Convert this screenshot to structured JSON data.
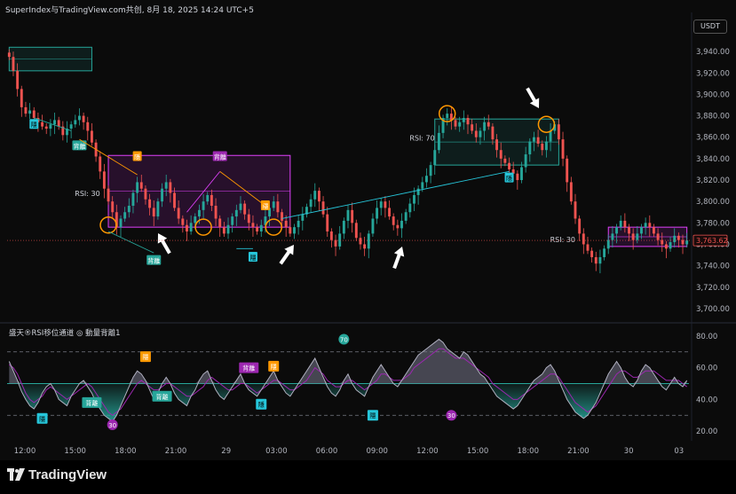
{
  "header": {
    "title": "SuperIndex与TradingView.com共创, 8月 18, 2025 14:24 UTC+5",
    "currency": "USDT",
    "brand": "TradingView"
  },
  "indicator": {
    "legend": "盛天®RSI移位通道 ◎ 動量背離1"
  },
  "colors": {
    "up": "#26a69a",
    "down": "#ef5350",
    "rsi_hi": "#e040fb",
    "rsi_lo": "#26c6da",
    "orange": "#ff9800",
    "background": "#0b0b0b"
  },
  "chart_data": [
    {
      "type": "candlestick",
      "title": "",
      "x_ticks": [
        "12:00",
        "15:00",
        "18:00",
        "21:00",
        "29",
        "03:00",
        "06:00",
        "09:00",
        "12:00",
        "15:00",
        "18:00",
        "21:00",
        "30",
        "03"
      ],
      "y_ticks": [
        3940,
        3920,
        3900,
        3880,
        3860,
        3840,
        3820,
        3800,
        3780,
        3760,
        3740,
        3720,
        3700
      ],
      "ylim": [
        3690,
        3955
      ],
      "last_price": "3,763.62",
      "close": [
        3935,
        3922,
        3905,
        3888,
        3882,
        3885,
        3878,
        3874,
        3870,
        3868,
        3872,
        3876,
        3870,
        3862,
        3868,
        3872,
        3876,
        3880,
        3874,
        3866,
        3855,
        3842,
        3828,
        3812,
        3800,
        3790,
        3776,
        3784,
        3790,
        3796,
        3808,
        3818,
        3812,
        3802,
        3794,
        3786,
        3800,
        3812,
        3818,
        3808,
        3794,
        3784,
        3778,
        3772,
        3780,
        3786,
        3792,
        3800,
        3806,
        3796,
        3784,
        3776,
        3770,
        3778,
        3786,
        3792,
        3798,
        3788,
        3780,
        3776,
        3772,
        3778,
        3786,
        3794,
        3800,
        3790,
        3782,
        3776,
        3770,
        3776,
        3782,
        3788,
        3795,
        3802,
        3810,
        3800,
        3788,
        3772,
        3764,
        3758,
        3770,
        3782,
        3792,
        3780,
        3766,
        3760,
        3756,
        3770,
        3784,
        3794,
        3800,
        3794,
        3786,
        3778,
        3775,
        3782,
        3790,
        3798,
        3806,
        3812,
        3818,
        3824,
        3834,
        3848,
        3864,
        3878,
        3882,
        3876,
        3870,
        3874,
        3878,
        3872,
        3866,
        3860,
        3866,
        3874,
        3870,
        3858,
        3848,
        3840,
        3836,
        3830,
        3826,
        3820,
        3832,
        3844,
        3856,
        3860,
        3854,
        3848,
        3856,
        3866,
        3872,
        3858,
        3840,
        3818,
        3800,
        3784,
        3770,
        3760,
        3754,
        3748,
        3742,
        3748,
        3756,
        3764,
        3770,
        3776,
        3782,
        3776,
        3770,
        3764,
        3770,
        3776,
        3780,
        3776,
        3770,
        3764,
        3760,
        3756,
        3762,
        3768,
        3764,
        3760,
        3763.62
      ]
    },
    {
      "type": "line",
      "title": "",
      "y_ticks": [
        80,
        60,
        40,
        20
      ],
      "ylim": [
        15,
        85
      ],
      "bands": {
        "upper": 70,
        "lower": 30,
        "mid": 50
      },
      "series": [
        {
          "values": [
            64,
            58,
            52,
            45,
            40,
            36,
            34,
            38,
            44,
            48,
            50,
            46,
            40,
            38,
            36,
            42,
            46,
            50,
            52,
            48,
            44,
            38,
            34,
            30,
            28,
            26,
            30,
            36,
            42,
            48,
            54,
            58,
            56,
            52,
            46,
            40,
            44,
            50,
            54,
            50,
            44,
            40,
            38,
            36,
            42,
            46,
            52,
            56,
            58,
            52,
            46,
            42,
            40,
            44,
            48,
            52,
            56,
            50,
            46,
            44,
            42,
            46,
            50,
            54,
            58,
            52,
            48,
            44,
            42,
            46,
            50,
            54,
            58,
            62,
            66,
            60,
            54,
            48,
            44,
            42,
            46,
            52,
            56,
            50,
            46,
            44,
            42,
            48,
            54,
            58,
            62,
            58,
            54,
            50,
            48,
            52,
            56,
            60,
            64,
            68,
            70,
            72,
            74,
            76,
            78,
            76,
            72,
            70,
            68,
            66,
            70,
            68,
            64,
            60,
            56,
            54,
            50,
            46,
            42,
            40,
            38,
            36,
            34,
            36,
            40,
            44,
            48,
            52,
            54,
            56,
            60,
            62,
            58,
            52,
            46,
            40,
            36,
            32,
            30,
            28,
            30,
            34,
            38,
            44,
            50,
            56,
            60,
            64,
            60,
            54,
            50,
            48,
            52,
            58,
            62,
            60,
            56,
            52,
            48,
            46,
            50,
            54,
            50,
            48,
            52
          ]
        },
        {
          "values": [
            62,
            60,
            56,
            50,
            44,
            40,
            38,
            40,
            42,
            46,
            48,
            46,
            44,
            42,
            40,
            42,
            44,
            46,
            48,
            50,
            48,
            44,
            40,
            36,
            32,
            30,
            32,
            34,
            38,
            42,
            46,
            50,
            52,
            50,
            48,
            46,
            46,
            48,
            50,
            50,
            48,
            46,
            44,
            42,
            42,
            44,
            46,
            48,
            52,
            54,
            52,
            50,
            48,
            46,
            46,
            48,
            50,
            50,
            48,
            46,
            44,
            46,
            48,
            50,
            52,
            52,
            50,
            48,
            46,
            46,
            48,
            50,
            52,
            56,
            60,
            58,
            56,
            52,
            50,
            48,
            48,
            50,
            52,
            52,
            50,
            48,
            46,
            48,
            50,
            52,
            56,
            56,
            54,
            52,
            52,
            52,
            54,
            56,
            60,
            62,
            64,
            66,
            68,
            70,
            72,
            72,
            70,
            68,
            66,
            66,
            66,
            64,
            62,
            60,
            58,
            56,
            54,
            50,
            48,
            46,
            44,
            42,
            40,
            40,
            42,
            44,
            46,
            48,
            50,
            52,
            54,
            56,
            56,
            54,
            50,
            46,
            42,
            38,
            36,
            34,
            32,
            34,
            36,
            40,
            44,
            48,
            52,
            56,
            58,
            58,
            56,
            54,
            54,
            56,
            58,
            58,
            58,
            56,
            54,
            52,
            52,
            52,
            52,
            50,
            48
          ]
        }
      ]
    }
  ],
  "annotations": {
    "rsi70_label": "RSI: 70",
    "rsi30_label_left": "RSI: 30",
    "rsi30_label_right": "RSI: 30",
    "tag_hidden": "隱",
    "tag_div": "背離",
    "tag_70": "70",
    "tag_30": "30"
  }
}
